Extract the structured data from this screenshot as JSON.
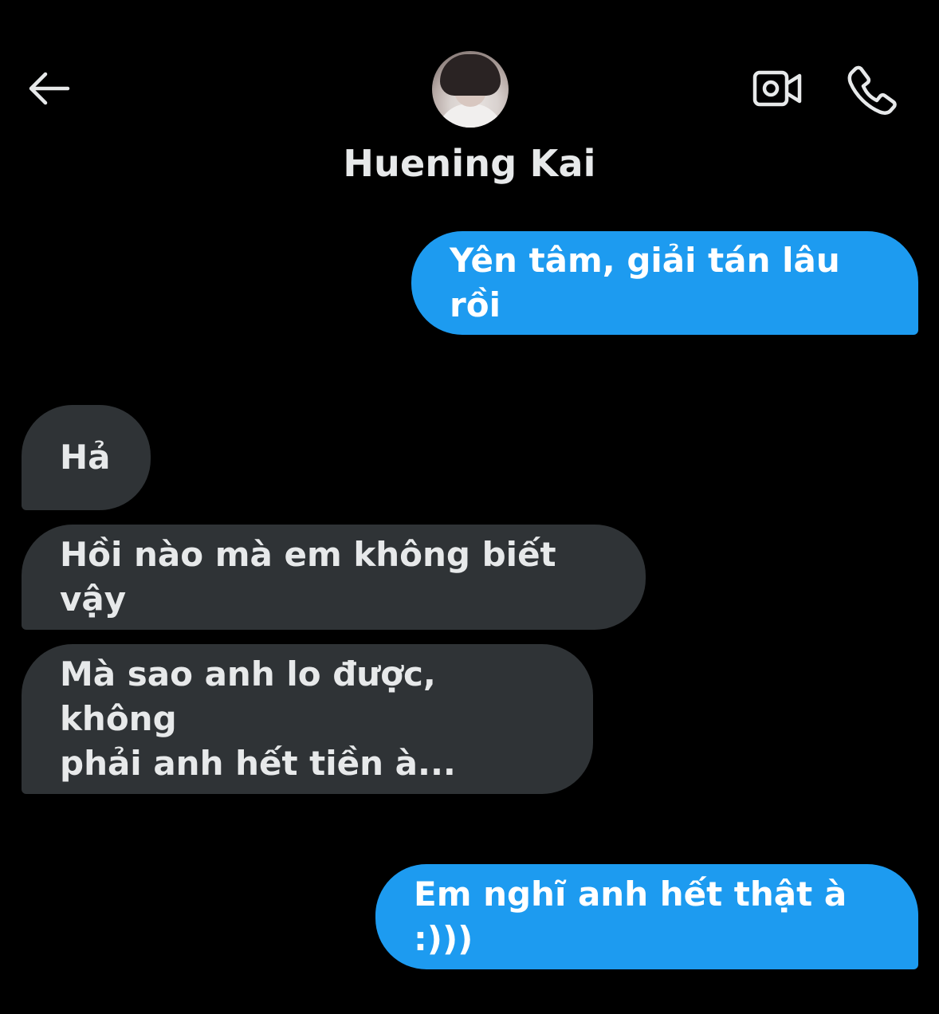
{
  "header": {
    "contact_name": "Huening Kai",
    "back_icon": "arrow-left-icon",
    "video_icon": "video-camera-icon",
    "call_icon": "phone-icon"
  },
  "messages": [
    {
      "direction": "sent",
      "text": "Yên tâm, giải tán lâu rồi"
    },
    {
      "direction": "received",
      "text": "Hả"
    },
    {
      "direction": "received",
      "text": "Hồi nào mà em không biết vậy"
    },
    {
      "direction": "received",
      "text": "Mà sao anh lo được, không\nphải anh hết tiền à..."
    },
    {
      "direction": "sent",
      "text": "Em nghĩ anh hết thật à :)))"
    }
  ],
  "colors": {
    "background": "#000000",
    "sent_bubble": "#1d9bf0",
    "received_bubble": "#2f3336",
    "text": "#e7e9ea"
  }
}
